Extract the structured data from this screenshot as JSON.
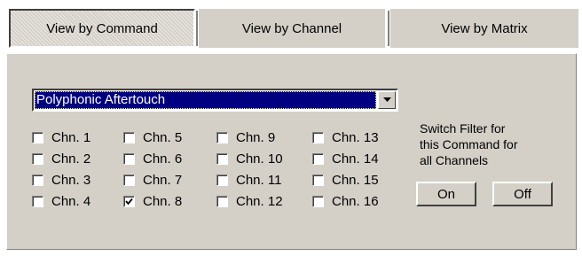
{
  "tabs": [
    {
      "label": "View by Command",
      "active": true
    },
    {
      "label": "View by Channel",
      "active": false
    },
    {
      "label": "View by Matrix",
      "active": false
    }
  ],
  "command_select": {
    "value": "Polyphonic Aftertouch"
  },
  "channels": [
    {
      "label": "Chn. 1",
      "checked": false
    },
    {
      "label": "Chn. 2",
      "checked": false
    },
    {
      "label": "Chn. 3",
      "checked": false
    },
    {
      "label": "Chn. 4",
      "checked": false
    },
    {
      "label": "Chn. 5",
      "checked": false
    },
    {
      "label": "Chn. 6",
      "checked": false
    },
    {
      "label": "Chn. 7",
      "checked": false
    },
    {
      "label": "Chn. 8",
      "checked": true
    },
    {
      "label": "Chn. 9",
      "checked": false
    },
    {
      "label": "Chn. 10",
      "checked": false
    },
    {
      "label": "Chn. 11",
      "checked": false
    },
    {
      "label": "Chn. 12",
      "checked": false
    },
    {
      "label": "Chn. 13",
      "checked": false
    },
    {
      "label": "Chn. 14",
      "checked": false
    },
    {
      "label": "Chn. 15",
      "checked": false
    },
    {
      "label": "Chn. 16",
      "checked": false
    }
  ],
  "switch_filter": {
    "lines": [
      "Switch Filter for",
      "this Command for",
      "all Channels"
    ],
    "on_label": "On",
    "off_label": "Off"
  }
}
